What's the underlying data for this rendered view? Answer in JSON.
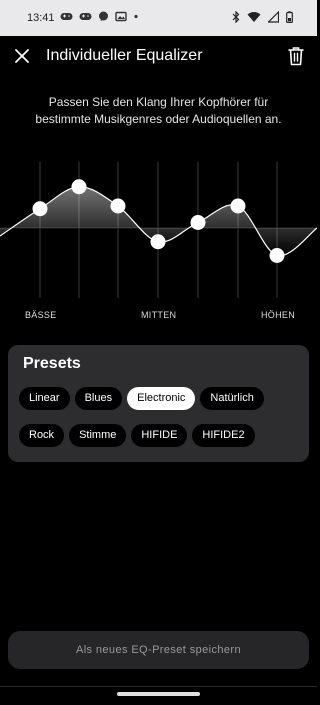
{
  "status_bar": {
    "time": "13:41",
    "left_icons": [
      "gamepad-icon",
      "gamepad-icon",
      "messenger-icon",
      "photo-gallery-icon",
      "notification-dot-icon"
    ],
    "right_icons": [
      "bluetooth-icon",
      "wifi-icon",
      "signal-icon",
      "battery-icon"
    ]
  },
  "header": {
    "title": "Individueller Equalizer",
    "close_icon": "close-icon",
    "delete_icon": "trash-icon"
  },
  "description": "Passen Sie den Klang Ihrer Kopfhörer für bestimmte Musikgenres oder Audioquellen an.",
  "equalizer": {
    "bands": [
      {
        "band": 1,
        "level": 0.35
      },
      {
        "band": 2,
        "level": 0.75
      },
      {
        "band": 3,
        "level": 0.4
      },
      {
        "band": 4,
        "level": -0.25
      },
      {
        "band": 5,
        "level": 0.1
      },
      {
        "band": 6,
        "level": 0.4
      },
      {
        "band": 7,
        "level": -0.5
      }
    ],
    "labels": {
      "low": "BÄSSE",
      "mid": "MITTEN",
      "high": "HÖHEN"
    }
  },
  "presets": {
    "title": "Presets",
    "rows": [
      [
        {
          "label": "Linear",
          "active": false
        },
        {
          "label": "Blues",
          "active": false
        },
        {
          "label": "Electronic",
          "active": true
        },
        {
          "label": "Natürlich",
          "active": false
        }
      ],
      [
        {
          "label": "Rock",
          "active": false
        },
        {
          "label": "Stimme",
          "active": false
        },
        {
          "label": "HIFIDE",
          "active": false
        },
        {
          "label": "HIFIDE2",
          "active": false
        }
      ]
    ]
  },
  "save_button": "Als neues EQ-Preset speichern",
  "colors": {
    "background": "#000000",
    "status_bar": "#e9e9ec",
    "card": "#2d2d2f",
    "chip": "#000000",
    "chip_active": "#ffffff",
    "button": "#262628",
    "button_text": "#9a9a9a"
  }
}
